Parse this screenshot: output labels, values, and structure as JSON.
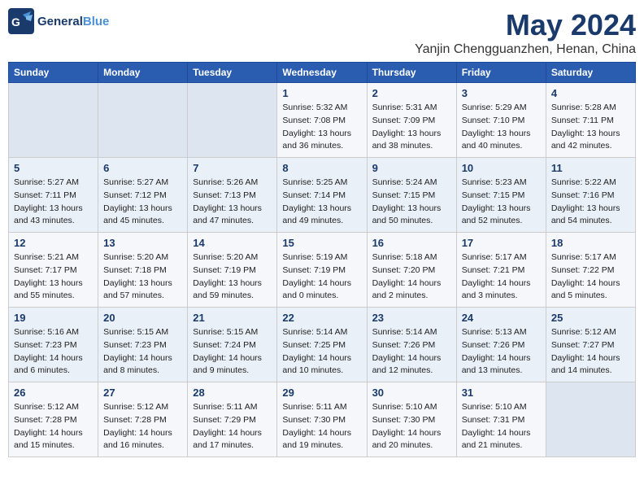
{
  "header": {
    "logo_general": "General",
    "logo_blue": "Blue",
    "month": "May 2024",
    "location": "Yanjin Chengguanzhen, Henan, China"
  },
  "weekdays": [
    "Sunday",
    "Monday",
    "Tuesday",
    "Wednesday",
    "Thursday",
    "Friday",
    "Saturday"
  ],
  "weeks": [
    [
      {
        "day": null
      },
      {
        "day": null
      },
      {
        "day": null
      },
      {
        "day": "1",
        "sunrise": "Sunrise: 5:32 AM",
        "sunset": "Sunset: 7:08 PM",
        "daylight": "Daylight: 13 hours and 36 minutes."
      },
      {
        "day": "2",
        "sunrise": "Sunrise: 5:31 AM",
        "sunset": "Sunset: 7:09 PM",
        "daylight": "Daylight: 13 hours and 38 minutes."
      },
      {
        "day": "3",
        "sunrise": "Sunrise: 5:29 AM",
        "sunset": "Sunset: 7:10 PM",
        "daylight": "Daylight: 13 hours and 40 minutes."
      },
      {
        "day": "4",
        "sunrise": "Sunrise: 5:28 AM",
        "sunset": "Sunset: 7:11 PM",
        "daylight": "Daylight: 13 hours and 42 minutes."
      }
    ],
    [
      {
        "day": "5",
        "sunrise": "Sunrise: 5:27 AM",
        "sunset": "Sunset: 7:11 PM",
        "daylight": "Daylight: 13 hours and 43 minutes."
      },
      {
        "day": "6",
        "sunrise": "Sunrise: 5:27 AM",
        "sunset": "Sunset: 7:12 PM",
        "daylight": "Daylight: 13 hours and 45 minutes."
      },
      {
        "day": "7",
        "sunrise": "Sunrise: 5:26 AM",
        "sunset": "Sunset: 7:13 PM",
        "daylight": "Daylight: 13 hours and 47 minutes."
      },
      {
        "day": "8",
        "sunrise": "Sunrise: 5:25 AM",
        "sunset": "Sunset: 7:14 PM",
        "daylight": "Daylight: 13 hours and 49 minutes."
      },
      {
        "day": "9",
        "sunrise": "Sunrise: 5:24 AM",
        "sunset": "Sunset: 7:15 PM",
        "daylight": "Daylight: 13 hours and 50 minutes."
      },
      {
        "day": "10",
        "sunrise": "Sunrise: 5:23 AM",
        "sunset": "Sunset: 7:15 PM",
        "daylight": "Daylight: 13 hours and 52 minutes."
      },
      {
        "day": "11",
        "sunrise": "Sunrise: 5:22 AM",
        "sunset": "Sunset: 7:16 PM",
        "daylight": "Daylight: 13 hours and 54 minutes."
      }
    ],
    [
      {
        "day": "12",
        "sunrise": "Sunrise: 5:21 AM",
        "sunset": "Sunset: 7:17 PM",
        "daylight": "Daylight: 13 hours and 55 minutes."
      },
      {
        "day": "13",
        "sunrise": "Sunrise: 5:20 AM",
        "sunset": "Sunset: 7:18 PM",
        "daylight": "Daylight: 13 hours and 57 minutes."
      },
      {
        "day": "14",
        "sunrise": "Sunrise: 5:20 AM",
        "sunset": "Sunset: 7:19 PM",
        "daylight": "Daylight: 13 hours and 59 minutes."
      },
      {
        "day": "15",
        "sunrise": "Sunrise: 5:19 AM",
        "sunset": "Sunset: 7:19 PM",
        "daylight": "Daylight: 14 hours and 0 minutes."
      },
      {
        "day": "16",
        "sunrise": "Sunrise: 5:18 AM",
        "sunset": "Sunset: 7:20 PM",
        "daylight": "Daylight: 14 hours and 2 minutes."
      },
      {
        "day": "17",
        "sunrise": "Sunrise: 5:17 AM",
        "sunset": "Sunset: 7:21 PM",
        "daylight": "Daylight: 14 hours and 3 minutes."
      },
      {
        "day": "18",
        "sunrise": "Sunrise: 5:17 AM",
        "sunset": "Sunset: 7:22 PM",
        "daylight": "Daylight: 14 hours and 5 minutes."
      }
    ],
    [
      {
        "day": "19",
        "sunrise": "Sunrise: 5:16 AM",
        "sunset": "Sunset: 7:23 PM",
        "daylight": "Daylight: 14 hours and 6 minutes."
      },
      {
        "day": "20",
        "sunrise": "Sunrise: 5:15 AM",
        "sunset": "Sunset: 7:23 PM",
        "daylight": "Daylight: 14 hours and 8 minutes."
      },
      {
        "day": "21",
        "sunrise": "Sunrise: 5:15 AM",
        "sunset": "Sunset: 7:24 PM",
        "daylight": "Daylight: 14 hours and 9 minutes."
      },
      {
        "day": "22",
        "sunrise": "Sunrise: 5:14 AM",
        "sunset": "Sunset: 7:25 PM",
        "daylight": "Daylight: 14 hours and 10 minutes."
      },
      {
        "day": "23",
        "sunrise": "Sunrise: 5:14 AM",
        "sunset": "Sunset: 7:26 PM",
        "daylight": "Daylight: 14 hours and 12 minutes."
      },
      {
        "day": "24",
        "sunrise": "Sunrise: 5:13 AM",
        "sunset": "Sunset: 7:26 PM",
        "daylight": "Daylight: 14 hours and 13 minutes."
      },
      {
        "day": "25",
        "sunrise": "Sunrise: 5:12 AM",
        "sunset": "Sunset: 7:27 PM",
        "daylight": "Daylight: 14 hours and 14 minutes."
      }
    ],
    [
      {
        "day": "26",
        "sunrise": "Sunrise: 5:12 AM",
        "sunset": "Sunset: 7:28 PM",
        "daylight": "Daylight: 14 hours and 15 minutes."
      },
      {
        "day": "27",
        "sunrise": "Sunrise: 5:12 AM",
        "sunset": "Sunset: 7:28 PM",
        "daylight": "Daylight: 14 hours and 16 minutes."
      },
      {
        "day": "28",
        "sunrise": "Sunrise: 5:11 AM",
        "sunset": "Sunset: 7:29 PM",
        "daylight": "Daylight: 14 hours and 17 minutes."
      },
      {
        "day": "29",
        "sunrise": "Sunrise: 5:11 AM",
        "sunset": "Sunset: 7:30 PM",
        "daylight": "Daylight: 14 hours and 19 minutes."
      },
      {
        "day": "30",
        "sunrise": "Sunrise: 5:10 AM",
        "sunset": "Sunset: 7:30 PM",
        "daylight": "Daylight: 14 hours and 20 minutes."
      },
      {
        "day": "31",
        "sunrise": "Sunrise: 5:10 AM",
        "sunset": "Sunset: 7:31 PM",
        "daylight": "Daylight: 14 hours and 21 minutes."
      },
      {
        "day": null
      }
    ]
  ]
}
